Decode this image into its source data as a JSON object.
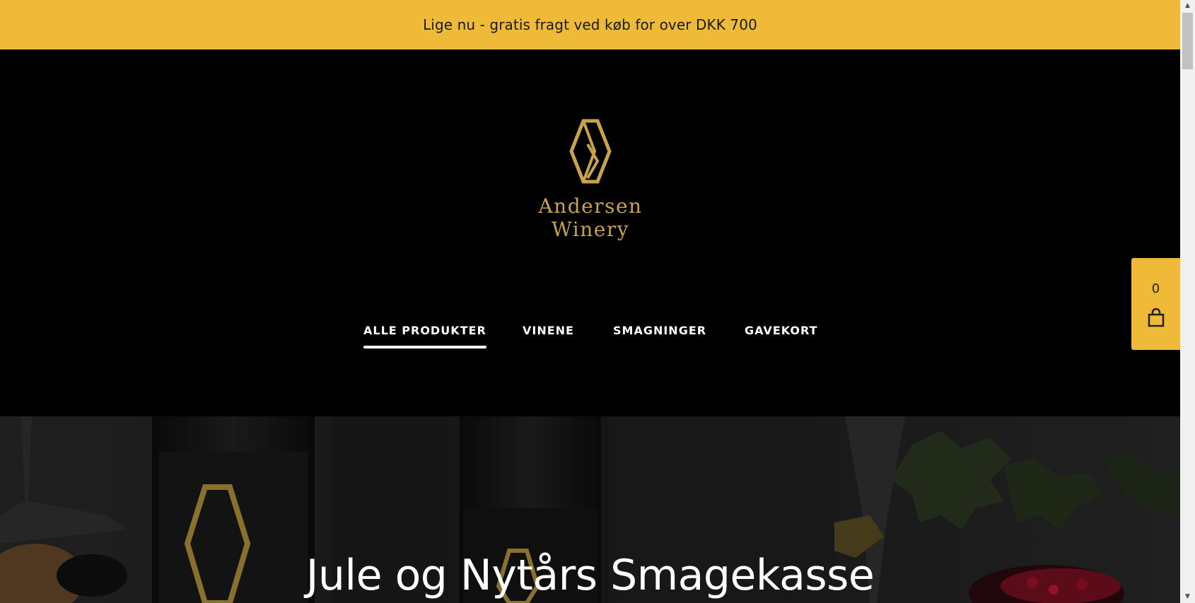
{
  "promo": {
    "text": "Lige nu - gratis fragt ved køb for over DKK 700"
  },
  "brand": {
    "line1": "Andersen",
    "line2": "Winery",
    "color": "#caa24a"
  },
  "nav": {
    "items": [
      {
        "label": "ALLE PRODUKTER",
        "active": true
      },
      {
        "label": "VINENE",
        "active": false
      },
      {
        "label": "SMAGNINGER",
        "active": false
      },
      {
        "label": "GAVEKORT",
        "active": false
      }
    ]
  },
  "hero": {
    "title": "Jule og Nytårs Smagekasse"
  },
  "cart": {
    "count": "0",
    "icon": "shopping-bag-icon"
  },
  "colors": {
    "accent": "#eeba37",
    "background": "#000000",
    "gold": "#caa24a"
  }
}
